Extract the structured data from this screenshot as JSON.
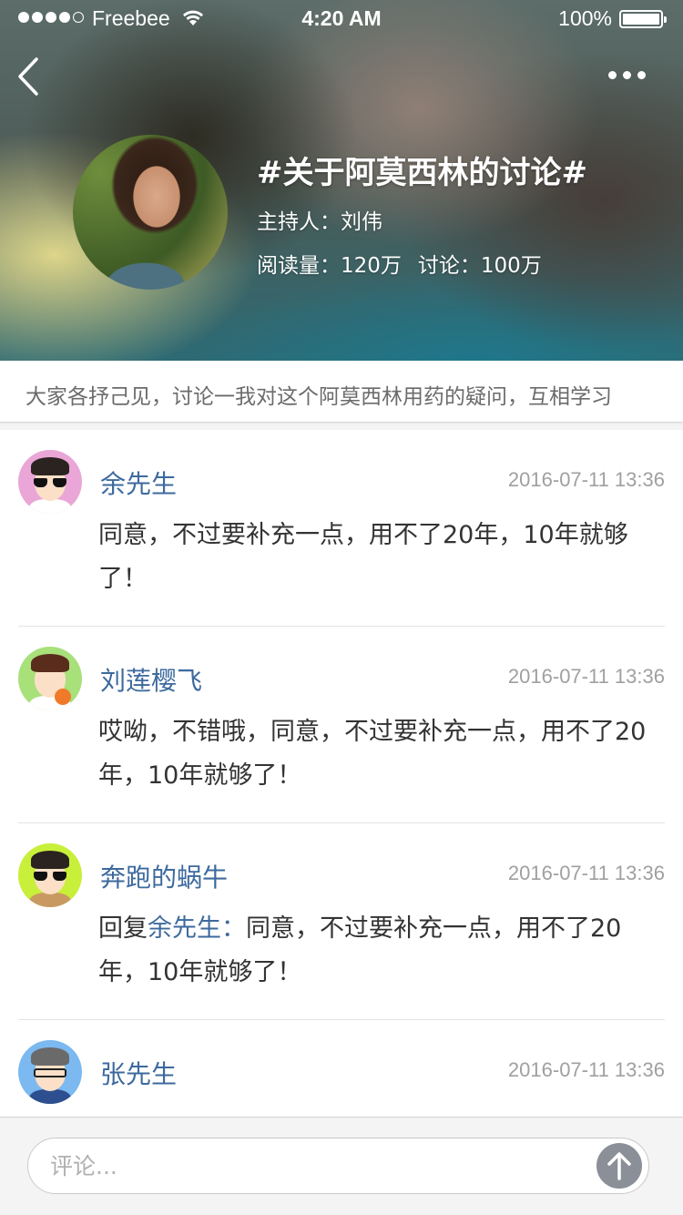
{
  "status_bar": {
    "carrier": "Freebee",
    "time": "4:20 AM",
    "battery": "100%",
    "battery_level": 1.0
  },
  "header": {
    "back_icon": "chevron-left-icon",
    "more_icon": "ellipsis-icon",
    "title": "#关于阿莫西林的讨论#",
    "host": "主持人：刘伟",
    "reads": "阅读量：120万",
    "discussions": "讨论：100万"
  },
  "description": "大家各抒己见，讨论一我对这个阿莫西林用药的疑问，互相学习",
  "comments": [
    {
      "name": "余先生",
      "time": "2016-07-11 13:36",
      "text": "同意，不过要补充一点，用不了20年，10年就够了！",
      "avatar_color": "#e9a6d6"
    },
    {
      "name": "刘莲樱飞",
      "time": "2016-07-11 13:36",
      "text": "哎呦，不错哦，同意，不过要补充一点，用不了20年，10年就够了！",
      "avatar_color": "#a8e07a"
    },
    {
      "name": "奔跑的蜗牛",
      "time": "2016-07-11 13:36",
      "reply_to": "余先生：",
      "reply_prefix": "回复",
      "text": "同意，不过要补充一点，用不了20年，10年就够了！",
      "avatar_color": "#c8ef3a"
    },
    {
      "name": "张先生",
      "time": "2016-07-11 13:36",
      "text": "",
      "avatar_color": "#7bb9f0"
    }
  ],
  "input": {
    "placeholder": "评论...",
    "send_icon": "arrow-up-icon"
  },
  "colors": {
    "name_blue": "#3d6a9e",
    "time_gray": "#a0a0a0",
    "send_button": "#8a8f98"
  }
}
